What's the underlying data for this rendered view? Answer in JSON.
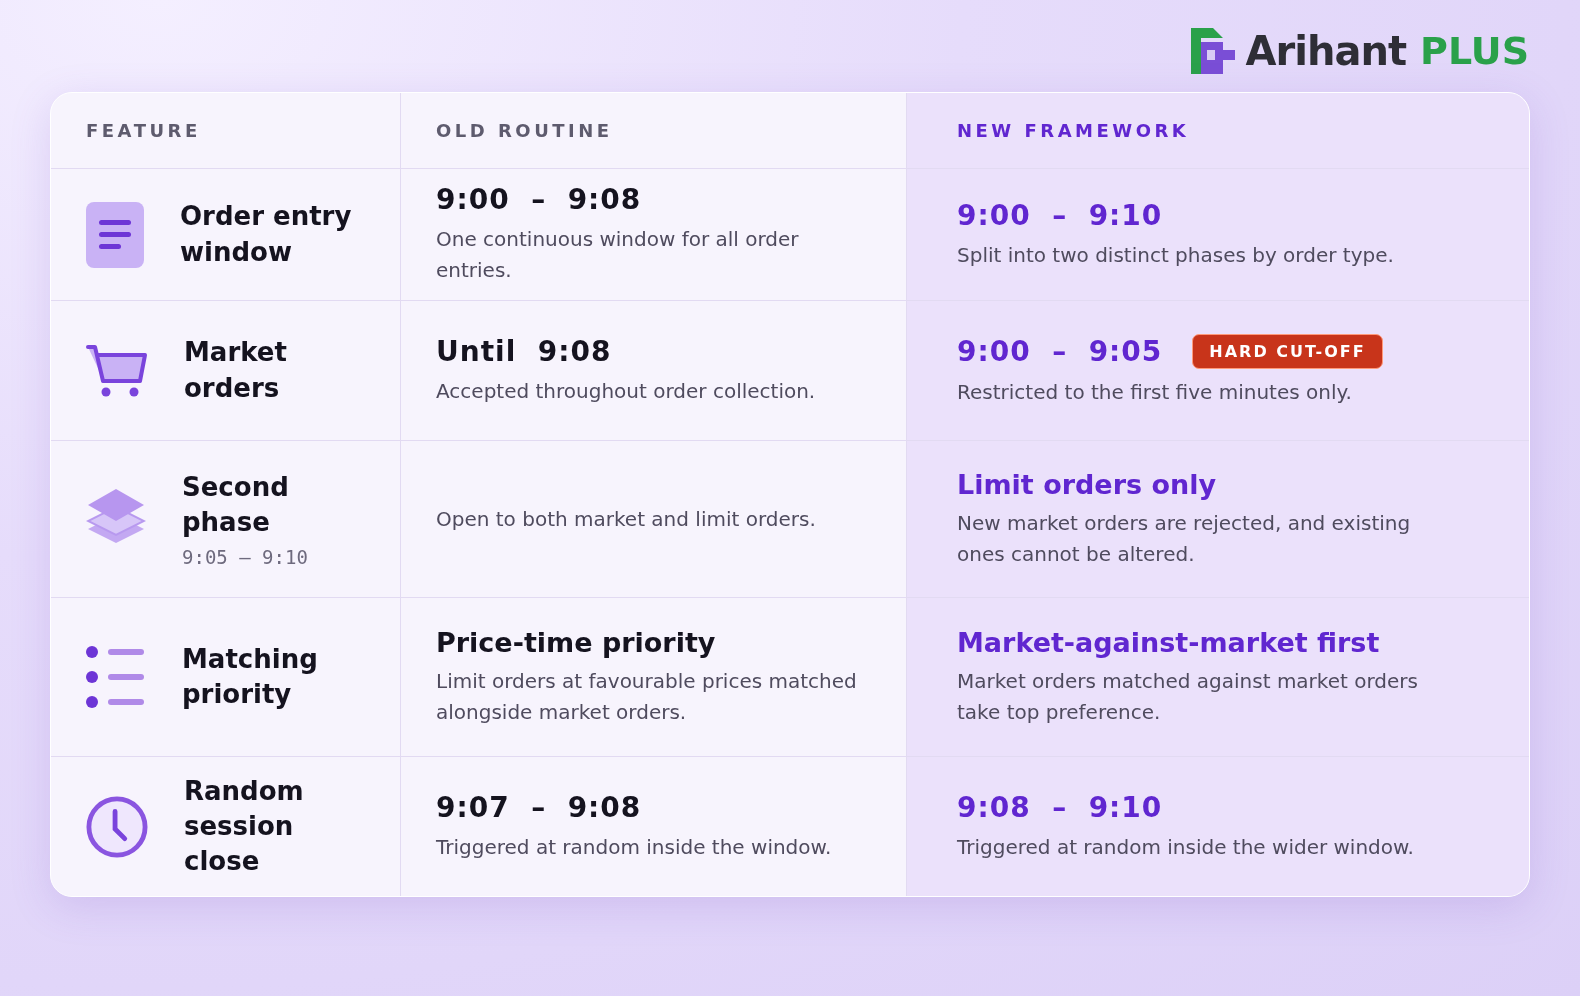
{
  "logo": {
    "name": "Arihant",
    "suffix": "PLUS"
  },
  "table": {
    "columns": [
      "FEATURE",
      "OLD ROUTINE",
      "NEW FRAMEWORK"
    ],
    "rows": [
      {
        "feature": {
          "title": "Order entry window"
        },
        "old": {
          "kind": "time",
          "heading": "9:00  –  9:08",
          "text": "One continuous window for all order entries."
        },
        "new": {
          "kind": "time",
          "heading": "9:00  –  9:10",
          "text": "Split into two distinct phases by order type."
        }
      },
      {
        "feature": {
          "title": "Market orders"
        },
        "old": {
          "kind": "time",
          "heading": "Until  9:08",
          "text": "Accepted throughout order collection."
        },
        "new": {
          "kind": "time",
          "heading": "9:00  –  9:05",
          "badge": "HARD CUT-OFF",
          "text": "Restricted to the first five minutes only."
        }
      },
      {
        "feature": {
          "title": "Second phase",
          "subtitle": "9:05  –  9:10"
        },
        "old": {
          "kind": "plain",
          "text": "Open to both market and limit orders."
        },
        "new": {
          "kind": "title",
          "heading": "Limit orders only",
          "text": "New market orders are rejected, and existing ones cannot be altered."
        }
      },
      {
        "feature": {
          "title": "Matching priority"
        },
        "old": {
          "kind": "title",
          "heading": "Price-time priority",
          "text": "Limit orders at favourable prices matched alongside market orders."
        },
        "new": {
          "kind": "title",
          "heading": "Market-against-market first",
          "text": "Market orders matched against market orders take top preference."
        }
      },
      {
        "feature": {
          "title": "Random session close"
        },
        "old": {
          "kind": "time",
          "heading": "9:07  –  9:08",
          "text": "Triggered at random inside the window."
        },
        "new": {
          "kind": "time",
          "heading": "9:08  –  9:10",
          "text": "Triggered at random inside the wider window."
        }
      }
    ]
  }
}
